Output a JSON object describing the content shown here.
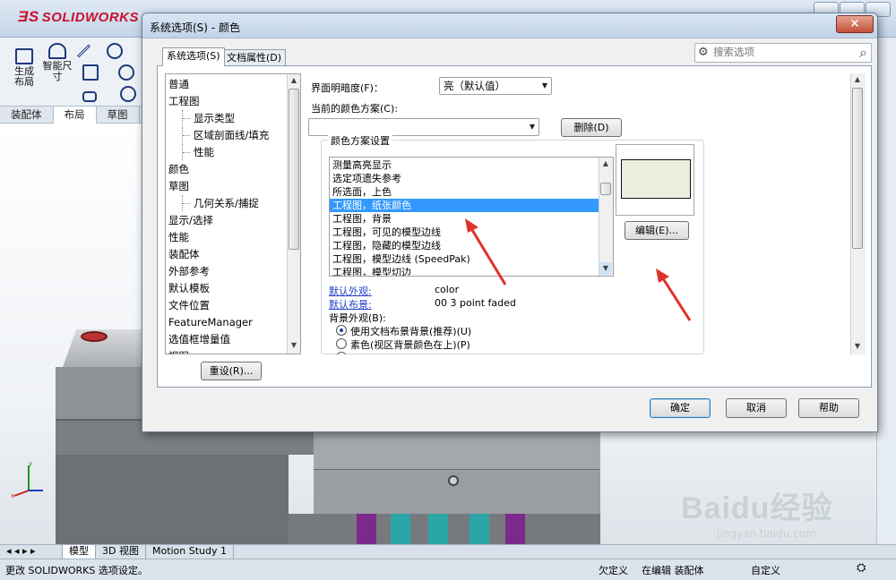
{
  "solidworks": {
    "logo": "SOLIDWORKS",
    "ribbon": {
      "generate_layout": "生成\n布局",
      "smart_dimension": "智能尺\n寸"
    },
    "command_tabs": [
      "装配体",
      "布局",
      "草图"
    ],
    "view_tabs": [
      "模型",
      "3D 视图",
      "Motion Study 1"
    ],
    "statusbar": {
      "message": "更改 SOLIDWORKS 选项设定。",
      "under_defined": "欠定义",
      "editing": "在编辑 装配体",
      "custom": "自定义"
    }
  },
  "dialog": {
    "title": "系统选项(S) - 颜色",
    "close_icon": "×",
    "search": {
      "placeholder": "搜索选项"
    },
    "tabs": {
      "system": "系统选项(S)",
      "document": "文档属性(D)"
    },
    "tree": [
      {
        "label": "普通",
        "level": 0
      },
      {
        "label": "工程图",
        "level": 0
      },
      {
        "label": "显示类型",
        "level": 1
      },
      {
        "label": "区域剖面线/填充",
        "level": 1
      },
      {
        "label": "性能",
        "level": 1
      },
      {
        "label": "颜色",
        "level": 0
      },
      {
        "label": "草图",
        "level": 0
      },
      {
        "label": "几何关系/捕捉",
        "level": 1
      },
      {
        "label": "显示/选择",
        "level": 0
      },
      {
        "label": "性能",
        "level": 0
      },
      {
        "label": "装配体",
        "level": 0
      },
      {
        "label": "外部参考",
        "level": 0
      },
      {
        "label": "默认模板",
        "level": 0
      },
      {
        "label": "文件位置",
        "level": 0
      },
      {
        "label": "FeatureManager",
        "level": 0
      },
      {
        "label": "选值框增量值",
        "level": 0
      },
      {
        "label": "视图",
        "level": 0
      }
    ],
    "reset_button": "重设(R)...",
    "brightness": {
      "label": "界面明暗度(F)：",
      "value": "亮（默认值）"
    },
    "current_scheme": {
      "label": "当前的颜色方案(C):",
      "value": "",
      "delete_button": "删除(D)"
    },
    "scheme_group": {
      "title": "颜色方案设置",
      "items": [
        "测量高亮显示",
        "选定项遗失参考",
        "所选面，上色",
        "工程图，纸张颜色",
        "工程图，背景",
        "工程图，可见的模型边线",
        "工程图，隐藏的模型边线",
        "工程图，模型边线 (SpeedPak)",
        "工程图，模型切边"
      ],
      "selected_index": 3,
      "edit_button": "编辑(E)...",
      "swatch_color": "#ededdf"
    },
    "default_appearance": {
      "label": "默认外观:",
      "value": "color"
    },
    "default_scene": {
      "label": "默认布景:",
      "value": "00 3 point faded"
    },
    "background": {
      "label": "背景外观(B):",
      "options": [
        {
          "label": "使用文档布景背景(推荐)(U)",
          "checked": true
        },
        {
          "label": "素色(视区背景颜色在上)(P)",
          "checked": false
        }
      ]
    },
    "buttons": {
      "ok": "确定",
      "cancel": "取消",
      "help": "帮助"
    }
  },
  "watermark": {
    "text": "Baidu经验",
    "url": "jingyan.baidu.com"
  },
  "colors": {
    "annotation_arrow": "#e0322c",
    "selection": "#3399ff",
    "link": "#1f3fc9"
  }
}
